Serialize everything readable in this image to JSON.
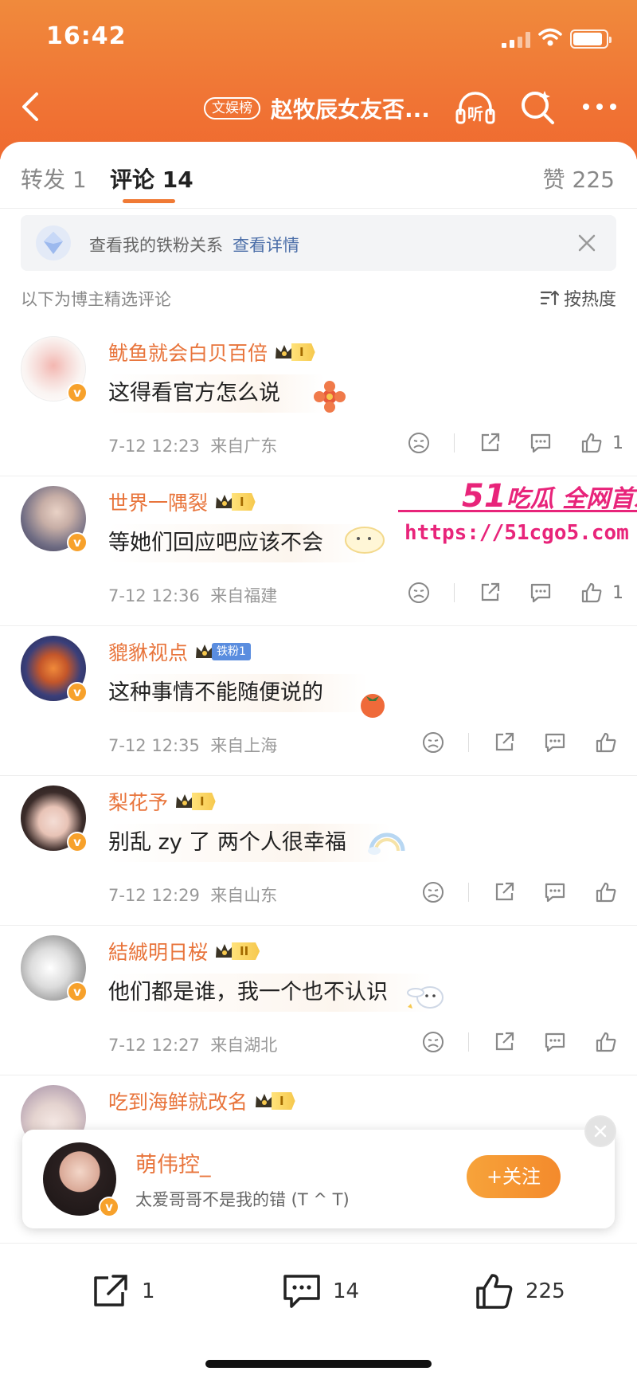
{
  "status_bar": {
    "time": "16:42"
  },
  "nav": {
    "badge": "文娱榜",
    "title": "赵牧辰女友否...",
    "listen_label": "听"
  },
  "tabs": {
    "repost": "转发 1",
    "comments": "评论 14",
    "likes": "赞 225"
  },
  "fan_bar": {
    "text": "查看我的铁粉关系",
    "link": "查看详情"
  },
  "section": {
    "label": "以下为博主精选评论",
    "sort": "按热度"
  },
  "colors": {
    "accent": "#f07a35",
    "username": "#e8743b",
    "link": "#4b6ea8",
    "watermark": "#e8247a"
  },
  "comments": [
    {
      "username": "鱿鱼就会白贝百倍",
      "level": "I",
      "text": "这得看官方怎么说",
      "time": "7-12 12:23",
      "location": "来自广东",
      "likes": "1"
    },
    {
      "username": "世界一隅裂",
      "level": "I",
      "text": "等她们回应吧应该不会",
      "time": "7-12 12:36",
      "location": "来自福建",
      "likes": "1"
    },
    {
      "username": "貔貅视点",
      "fan_tag": "铁粉1",
      "text": "这种事情不能随便说的",
      "time": "7-12 12:35",
      "location": "来自上海",
      "likes": ""
    },
    {
      "username": "梨花予",
      "level": "I",
      "text": "别乱 zy 了 两个人很幸福",
      "time": "7-12 12:29",
      "location": "来自山东",
      "likes": ""
    },
    {
      "username": "結絾明日桜",
      "level": "II",
      "text": "他们都是谁，我一个也不认识",
      "time": "7-12 12:27",
      "location": "来自湖北",
      "likes": ""
    },
    {
      "username": "吃到海鲜就改名",
      "level": "I"
    }
  ],
  "watermark": {
    "brand_num": "51",
    "brand_text": "吃瓜 全网首发",
    "url": "https://51cgo5.com"
  },
  "follow_popup": {
    "name": "萌伟控_",
    "desc": "太爱哥哥不是我的错 (T ^ T)",
    "button": "+关注"
  },
  "bottom_bar": {
    "reposts": "1",
    "comments": "14",
    "likes": "225"
  }
}
